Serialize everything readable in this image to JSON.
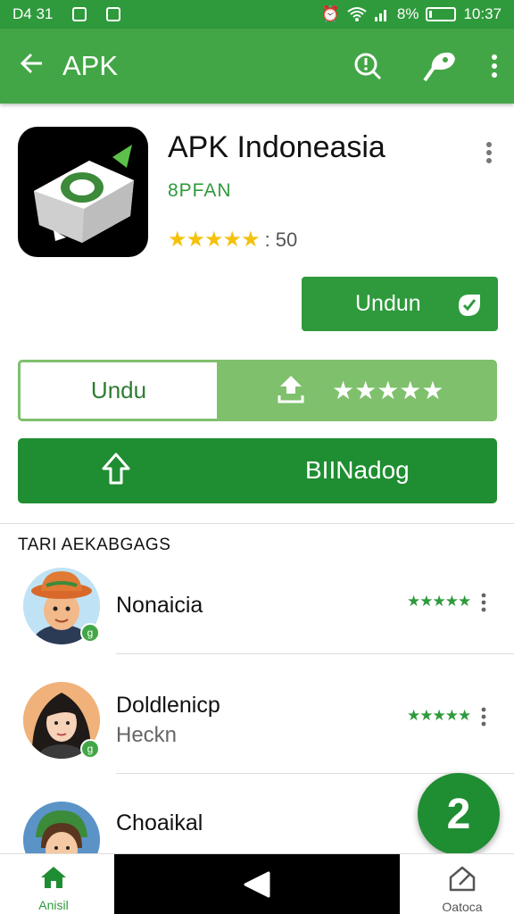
{
  "status_bar": {
    "left_text": "D4 31",
    "battery": "8%",
    "time": "10:37"
  },
  "app_bar": {
    "title": "APK"
  },
  "app": {
    "name": "APK Indoneasia",
    "developer": "8PFAN",
    "stars": "★★★★★",
    "rating": ": 50"
  },
  "buttons": {
    "install": "Undun",
    "split_left": "Undu",
    "split_stars": "★★★★★",
    "big": "BIINadog"
  },
  "section": {
    "title": "TARI AEKABGAGS"
  },
  "reviews": [
    {
      "name": "Nonaicia",
      "sub": "",
      "stars": "★★★★★"
    },
    {
      "name": "Doldlenicp",
      "sub": "Heckn",
      "stars": "★★★★★"
    },
    {
      "name": "Choaikal",
      "sub": "",
      "stars": ""
    }
  ],
  "fab": {
    "label": "2"
  },
  "bottom_nav": {
    "home_label": "Anisil",
    "right_label": "Oatoca"
  },
  "colors": {
    "primary": "#43a646",
    "dark": "#1f8d32",
    "light": "#7fc06c",
    "star_gold": "#f4c20d"
  }
}
